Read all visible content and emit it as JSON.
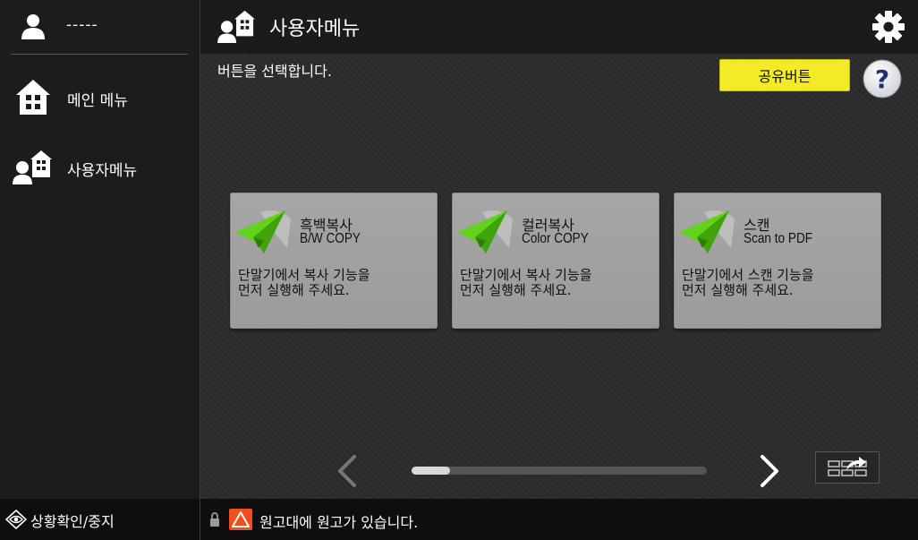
{
  "sidebar": {
    "user_name": "-----",
    "items": [
      {
        "label": "메인 메뉴",
        "icon": "home-icon"
      },
      {
        "label": "사용자메뉴",
        "icon": "user-menu-icon"
      }
    ]
  },
  "header": {
    "title": "사용자메뉴",
    "title_icon": "user-menu-icon",
    "settings_icon": "gear-icon"
  },
  "main": {
    "instruction": "버튼을 선택합니다.",
    "share_button_label": "공유버튼",
    "help_icon": "question-icon",
    "cards": [
      {
        "title": "흑백복사",
        "subtitle": "B/W COPY",
        "description": "단말기에서 복사 기능을\n먼저 실행해 주세요.",
        "icon": "paper-plane-icon"
      },
      {
        "title": "컬러복사",
        "subtitle": "Color COPY",
        "description": "단말기에서 복사 기능을\n먼저 실행해 주세요.",
        "icon": "paper-plane-icon"
      },
      {
        "title": "스캔",
        "subtitle": "Scan to PDF",
        "description": "단말기에서 스캔 기능을\n먼저 실행해 주세요.",
        "icon": "paper-plane-icon"
      }
    ],
    "pager": {
      "prev_icon": "chevron-left-icon",
      "next_icon": "chevron-right-icon",
      "scroll_position_fraction": 0.0,
      "scroll_thumb_fraction": 0.13,
      "switch_icon": "grid-switch-icon"
    }
  },
  "status_bar": {
    "left_label": "상황확인/중지",
    "left_icon": "eye-icon",
    "lock_icon": "lock-icon",
    "warning_icon": "warning-icon",
    "message": "원고대에 원고가 있습니다."
  },
  "colors": {
    "accent_yellow": "#f4ea28",
    "card_gray": "#a0a0a0",
    "plane_green": "#5fcc1e",
    "warning_orange": "#f04e1a"
  }
}
